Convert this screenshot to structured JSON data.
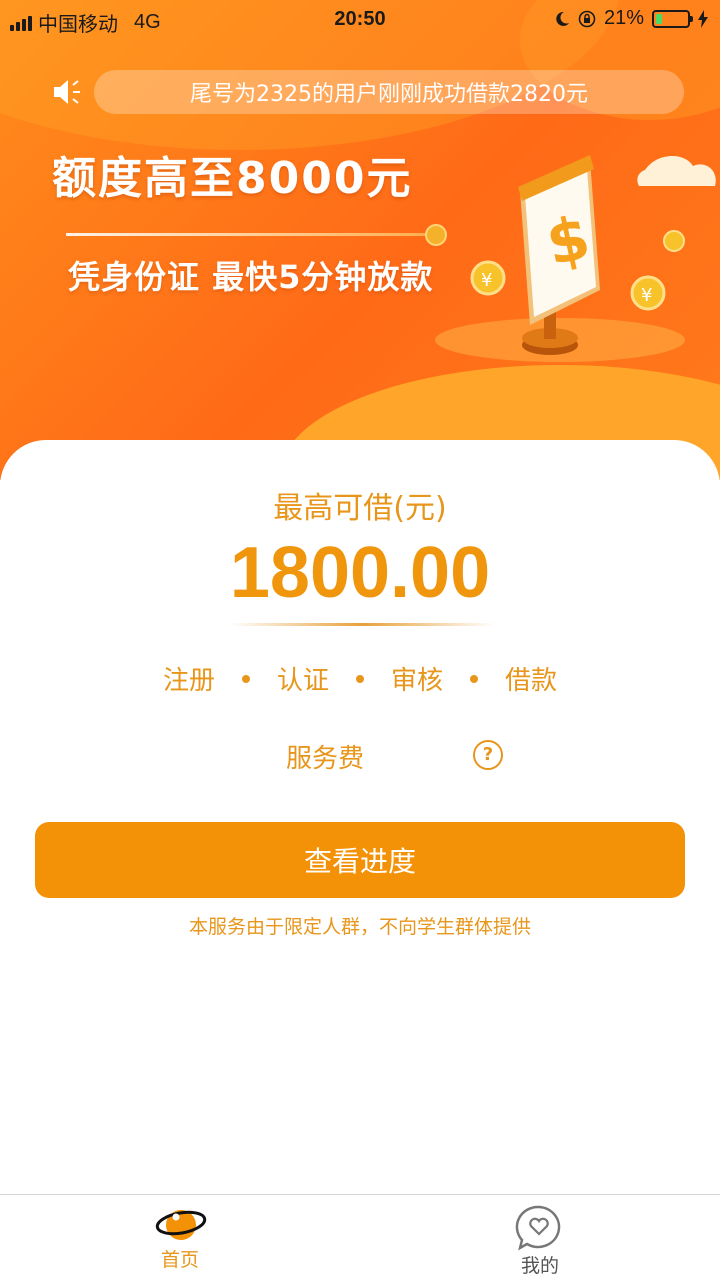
{
  "status_bar": {
    "carrier": "中国移动",
    "network": "4G",
    "time": "20:50",
    "battery": "21%",
    "battery_level": 0.21
  },
  "banner": {
    "notice": "尾号为2325的用户刚刚成功借款2820元",
    "headline": "额度高至8000元",
    "subline": "凭身份证 最快5分钟放款"
  },
  "loan": {
    "max_label": "最高可借(元)",
    "amount": "1800.00",
    "steps": [
      "注册",
      "认证",
      "审核",
      "借款"
    ],
    "fee_label": "服务费",
    "help_icon": "?",
    "button_label": "查看进度",
    "disclaimer": "本服务由于限定人群，不向学生群体提供"
  },
  "tabs": [
    {
      "label": "首页",
      "icon": "planet-icon",
      "active": true
    },
    {
      "label": "我的",
      "icon": "heart-chat-icon",
      "active": false
    }
  ],
  "colors": {
    "accent": "#f39206",
    "text_accent": "#e8961b",
    "banner": "#ff6a17"
  }
}
